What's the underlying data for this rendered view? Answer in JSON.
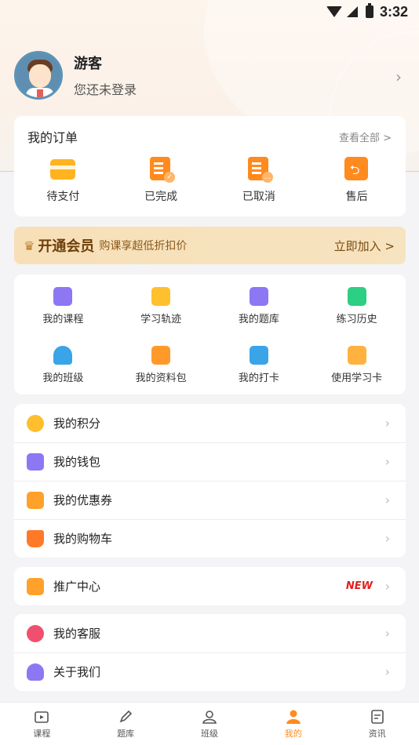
{
  "status_bar": {
    "time": "3:32"
  },
  "profile": {
    "name": "游客",
    "subtitle": "您还未登录"
  },
  "orders": {
    "title": "我的订单",
    "view_all": "查看全部 >",
    "items": [
      {
        "label": "待支付",
        "icon": "wallet-icon"
      },
      {
        "label": "已完成",
        "icon": "order-done-icon"
      },
      {
        "label": "已取消",
        "icon": "order-cancel-icon"
      },
      {
        "label": "售后",
        "icon": "after-sale-icon"
      }
    ]
  },
  "vip": {
    "title": "开通会员",
    "subtitle": "购课享超低折扣价",
    "join": "立即加入 >"
  },
  "grid": {
    "items": [
      {
        "label": "我的课程",
        "icon": "course-icon",
        "color": "#8d77f3"
      },
      {
        "label": "学习轨迹",
        "icon": "track-icon",
        "color": "#ffc02e"
      },
      {
        "label": "我的题库",
        "icon": "question-bank-icon",
        "color": "#8d77f3"
      },
      {
        "label": "练习历史",
        "icon": "history-icon",
        "color": "#2ccf83"
      },
      {
        "label": "我的班级",
        "icon": "class-icon",
        "color": "#3aa4e8"
      },
      {
        "label": "我的资料包",
        "icon": "folder-icon",
        "color": "#ff9a2a"
      },
      {
        "label": "我的打卡",
        "icon": "checkin-icon",
        "color": "#3aa4e8"
      },
      {
        "label": "使用学习卡",
        "icon": "study-card-icon",
        "color": "#ffb240"
      }
    ]
  },
  "list1": [
    {
      "label": "我的积分",
      "icon": "points-icon",
      "color": "#ffbe2e"
    },
    {
      "label": "我的钱包",
      "icon": "wallet-purple-icon",
      "color": "#8d77f3"
    },
    {
      "label": "我的优惠券",
      "icon": "coupon-icon",
      "color": "#ffa12a"
    },
    {
      "label": "我的购物车",
      "icon": "cart-icon",
      "color": "#ff7a28"
    }
  ],
  "list2": [
    {
      "label": "推广中心",
      "icon": "promotion-icon",
      "color": "#ffa12a",
      "badge": "NEW"
    }
  ],
  "list3": [
    {
      "label": "我的客服",
      "icon": "service-icon",
      "color": "#f0506e"
    },
    {
      "label": "关于我们",
      "icon": "about-icon",
      "color": "#8d77f3"
    }
  ],
  "bottom_nav": [
    {
      "label": "课程",
      "icon": "course-nav-icon"
    },
    {
      "label": "题库",
      "icon": "question-nav-icon"
    },
    {
      "label": "班级",
      "icon": "class-nav-icon"
    },
    {
      "label": "我的",
      "icon": "profile-nav-icon",
      "active": true
    },
    {
      "label": "资讯",
      "icon": "news-nav-icon"
    }
  ],
  "colors": {
    "accent": "#ff8a1e",
    "vip_text": "#6d3f0b",
    "badge_new": "#e02020"
  }
}
